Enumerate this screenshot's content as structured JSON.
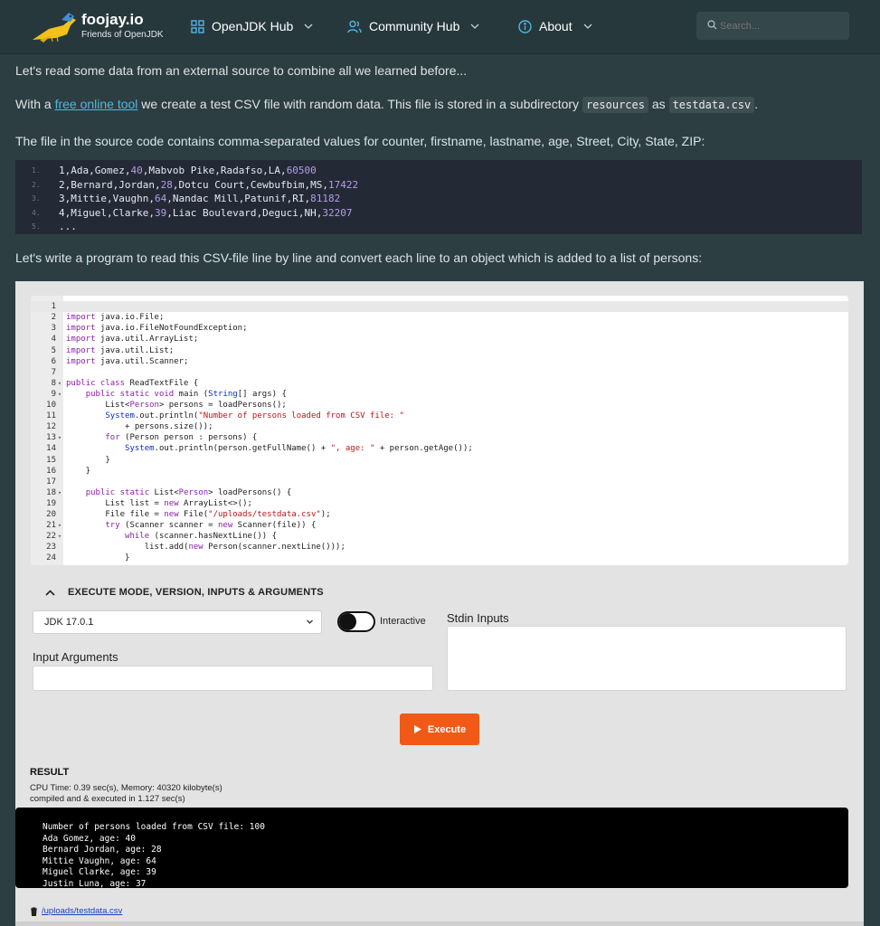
{
  "header": {
    "brand_name": "foojay.io",
    "brand_sub": "Friends of OpenJDK",
    "nav": [
      {
        "label": "OpenJDK Hub",
        "icon": "grid-icon"
      },
      {
        "label": "Community Hub",
        "icon": "users-icon"
      },
      {
        "label": "About",
        "icon": "info-icon"
      }
    ],
    "search_placeholder": "Search..."
  },
  "article": {
    "p1": "Let's read some data from an external source to combine all we learned before...",
    "p2_before": "With a ",
    "p2_link": "free online tool",
    "p2_middle": " we create a test CSV file with random data. This file is stored in a subdirectory ",
    "p2_code1": "resources",
    "p2_as": " as ",
    "p2_code2": "testdata.csv",
    "p2_end": ".",
    "p3": "The file in the source code contains comma-separated values for counter, firstname, lastname, age, Street, City, State, ZIP:",
    "csv_lines": [
      {
        "n": "1.",
        "pre": "1,Ada,Gomez,",
        "age": "40",
        "mid": ",Mabvob Pike,Radafso,LA,",
        "zip": "60500"
      },
      {
        "n": "2.",
        "pre": "2,Bernard,Jordan,",
        "age": "28",
        "mid": ",Dotcu Court,Cewbufbim,MS,",
        "zip": "17422"
      },
      {
        "n": "3.",
        "pre": "3,Mittie,Vaughn,",
        "age": "64",
        "mid": ",Nandac Mill,Patunif,RI,",
        "zip": "81182"
      },
      {
        "n": "4.",
        "pre": "4,Miguel,Clarke,",
        "age": "39",
        "mid": ",Liac Boulevard,Deguci,NH,",
        "zip": "32207"
      },
      {
        "n": "5.",
        "pre": "...",
        "age": "",
        "mid": "",
        "zip": ""
      }
    ],
    "p4": "Let's write a program to read this CSV-file line by line and convert each line to an object which is added to a list of persons:"
  },
  "compiler": {
    "code_lines": [
      {
        "n": "1",
        "fold": false,
        "html": ""
      },
      {
        "n": "2",
        "fold": false,
        "html": "<span class='kw'>import</span> java.io.File;"
      },
      {
        "n": "3",
        "fold": false,
        "html": "<span class='kw'>import</span> java.io.FileNotFoundException;"
      },
      {
        "n": "4",
        "fold": false,
        "html": "<span class='kw'>import</span> java.util.ArrayList;"
      },
      {
        "n": "5",
        "fold": false,
        "html": "<span class='kw'>import</span> java.util.List;"
      },
      {
        "n": "6",
        "fold": false,
        "html": "<span class='kw'>import</span> java.util.Scanner;"
      },
      {
        "n": "7",
        "fold": false,
        "html": ""
      },
      {
        "n": "8",
        "fold": true,
        "html": "<span class='kw'>public class</span> ReadTextFile {"
      },
      {
        "n": "9",
        "fold": true,
        "html": "    <span class='kw'>public static void</span> main (<span class='ty'>String</span>[] args) {"
      },
      {
        "n": "10",
        "fold": false,
        "html": "        List&lt;<span class='kw'>Person</span>&gt; persons = loadPersons();"
      },
      {
        "n": "11",
        "fold": false,
        "html": "        <span class='ty'>System</span>.out.println(<span class='str'>\"Number of persons loaded from CSV file: \"</span>"
      },
      {
        "n": "12",
        "fold": false,
        "html": "            + persons.size());"
      },
      {
        "n": "13",
        "fold": true,
        "html": "        <span class='kw'>for</span> (Person person : persons) {"
      },
      {
        "n": "14",
        "fold": false,
        "html": "            <span class='ty'>System</span>.out.println(person.getFullName() + <span class='str'>\", age: \"</span> + person.getAge());"
      },
      {
        "n": "15",
        "fold": false,
        "html": "        }"
      },
      {
        "n": "16",
        "fold": false,
        "html": "    }"
      },
      {
        "n": "17",
        "fold": false,
        "html": ""
      },
      {
        "n": "18",
        "fold": true,
        "html": "    <span class='kw'>public static</span> List&lt;<span class='kw'>Person</span>&gt; loadPersons() {"
      },
      {
        "n": "19",
        "fold": false,
        "html": "        List list = <span class='kw'>new</span> ArrayList&lt;&gt;();"
      },
      {
        "n": "20",
        "fold": false,
        "html": "        File file = <span class='kw'>new</span> File(<span class='str'>\"/uploads/testdata.csv\"</span>);"
      },
      {
        "n": "21",
        "fold": true,
        "html": "        <span class='kw'>try</span> (Scanner scanner = <span class='kw'>new</span> Scanner(file)) {"
      },
      {
        "n": "22",
        "fold": true,
        "html": "            <span class='kw'>while</span> (scanner.hasNextLine()) {"
      },
      {
        "n": "23",
        "fold": false,
        "html": "                list.add(<span class='kw'>new</span> Person(scanner.nextLine()));"
      },
      {
        "n": "24",
        "fold": false,
        "html": "            }"
      }
    ],
    "section_title": "EXECUTE MODE, VERSION, INPUTS & ARGUMENTS",
    "jdk_version": "JDK 17.0.1",
    "interactive_label": "Interactive",
    "stdin_label": "Stdin Inputs",
    "args_label": "Input Arguments",
    "execute_label": "Execute",
    "result_title": "RESULT",
    "result_cpu": "CPU Time: 0.39 sec(s), Memory: 40320 kilobyte(s)",
    "result_compiled": "compiled and & executed in 1.127 sec(s)",
    "output_lines": [
      "Number of persons loaded from CSV file: 100",
      "Ada Gomez, age: 40",
      "Bernard Jordan, age: 28",
      "Mittie Vaughn, age: 64",
      "Miguel Clarke, age: 39",
      "Justin Luna, age: 37"
    ],
    "file_link": "/uploads/testdata.csv"
  },
  "colors": {
    "page_bg": "#2c3e42",
    "link": "#4fb7e3",
    "execute": "#f15a16"
  }
}
